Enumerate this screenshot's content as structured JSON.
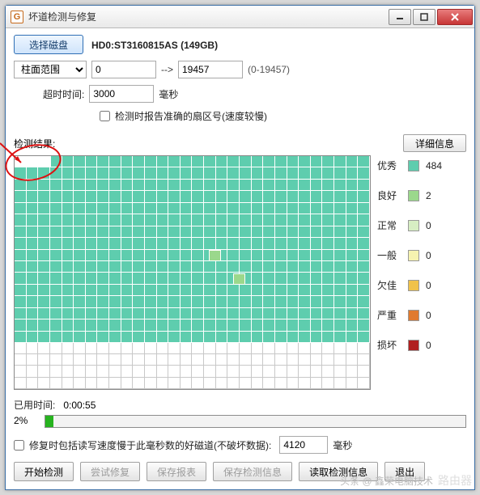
{
  "titlebar": {
    "title": "坏道检测与修复"
  },
  "controls": {
    "select_disk": "选择磁盘",
    "disk_info": "HD0:ST3160815AS (149GB)",
    "range_mode_options": [
      "柱面范围"
    ],
    "range_mode": "柱面范围",
    "range_from": "0",
    "arrow": "-->",
    "range_to": "19457",
    "range_hint": "(0-19457)",
    "timeout_label": "超时时间:",
    "timeout_value": "3000",
    "timeout_unit": "毫秒",
    "accurate_checkbox": "检测时报告准确的扇区号(速度较慢)"
  },
  "results": {
    "label": "检测结果:",
    "detail_btn": "详细信息"
  },
  "legend": {
    "items": [
      {
        "name": "优秀",
        "color": "#5ecdae",
        "count": 484
      },
      {
        "name": "良好",
        "color": "#9bd88c",
        "count": 2
      },
      {
        "name": "正常",
        "color": "#d7eec3",
        "count": 0
      },
      {
        "name": "一般",
        "color": "#f6f3b0",
        "count": 0
      },
      {
        "name": "欠佳",
        "color": "#f0c24a",
        "count": 0
      },
      {
        "name": "严重",
        "color": "#e07a2f",
        "count": 0
      },
      {
        "name": "损坏",
        "color": "#b02020",
        "count": 0
      }
    ]
  },
  "progress": {
    "used_label": "已用时间:",
    "used_time": "0:00:55",
    "percent_label": "2%",
    "percent": 2
  },
  "repair": {
    "checkbox_label": "修复时包括读写速度慢于此毫秒数的好磁道(不破坏数据):",
    "ms_value": "4120",
    "ms_unit": "毫秒"
  },
  "buttons": {
    "start": "开始检测",
    "try_repair": "尝试修复",
    "save_report": "保存报表",
    "save_info": "保存检测信息",
    "read_info": "读取检测信息",
    "exit": "退出"
  },
  "watermark": {
    "src": "头条 @ 鑫荣电脑技术",
    "brand": "路由器"
  }
}
